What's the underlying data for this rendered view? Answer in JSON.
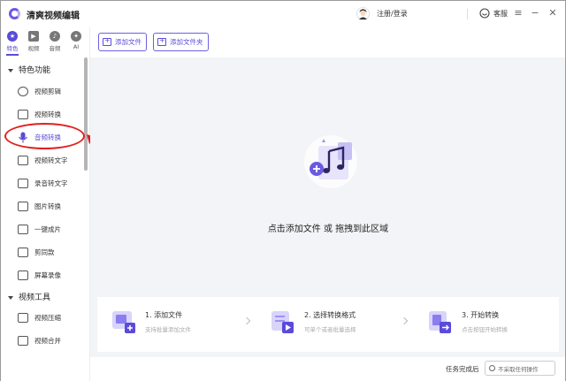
{
  "app": {
    "title": "清爽视频编辑",
    "login": "注册/登录",
    "service": "客服",
    "colors": {
      "accent": "#5a4bd8",
      "annotation": "#e02020"
    }
  },
  "sidebar": {
    "tabs": [
      {
        "label": "特色",
        "icon": "star-icon"
      },
      {
        "label": "视频",
        "icon": "video-icon"
      },
      {
        "label": "音频",
        "icon": "audio-icon"
      },
      {
        "label": "AI",
        "icon": "ai-icon"
      }
    ],
    "sections": [
      {
        "title": "特色功能",
        "items": [
          {
            "label": "视频剪辑",
            "icon": "video-edit-icon"
          },
          {
            "label": "视频转换",
            "icon": "video-convert-icon"
          },
          {
            "label": "音频转换",
            "icon": "microphone-icon"
          },
          {
            "label": "视频转文字",
            "icon": "video-to-text-icon"
          },
          {
            "label": "录音转文字",
            "icon": "audio-to-text-icon"
          },
          {
            "label": "图片转换",
            "icon": "image-convert-icon"
          },
          {
            "label": "一键成片",
            "icon": "one-click-film-icon"
          },
          {
            "label": "剪同款",
            "icon": "template-icon"
          },
          {
            "label": "屏幕录像",
            "icon": "screen-record-icon"
          }
        ]
      },
      {
        "title": "视频工具",
        "items": [
          {
            "label": "视频压缩",
            "icon": "video-compress-icon"
          },
          {
            "label": "视频合并",
            "icon": "video-merge-icon"
          }
        ]
      }
    ],
    "selected": "音频转换"
  },
  "toolbar": {
    "add_file": "添加文件",
    "add_folder": "添加文件夹"
  },
  "dropzone": {
    "text": "点击添加文件 或 拖拽到此区域"
  },
  "steps": [
    {
      "title": "1. 添加文件",
      "desc": "支持批量添加文件",
      "icon": "add-file-icon"
    },
    {
      "title": "2. 选择转换格式",
      "desc": "可单个或者批量选择",
      "icon": "format-list-icon"
    },
    {
      "title": "3. 开始转换",
      "desc": "点击按钮开始转换",
      "icon": "start-convert-icon"
    }
  ],
  "footer": {
    "label": "任务完成后",
    "select_value": "不采取任何操作"
  }
}
